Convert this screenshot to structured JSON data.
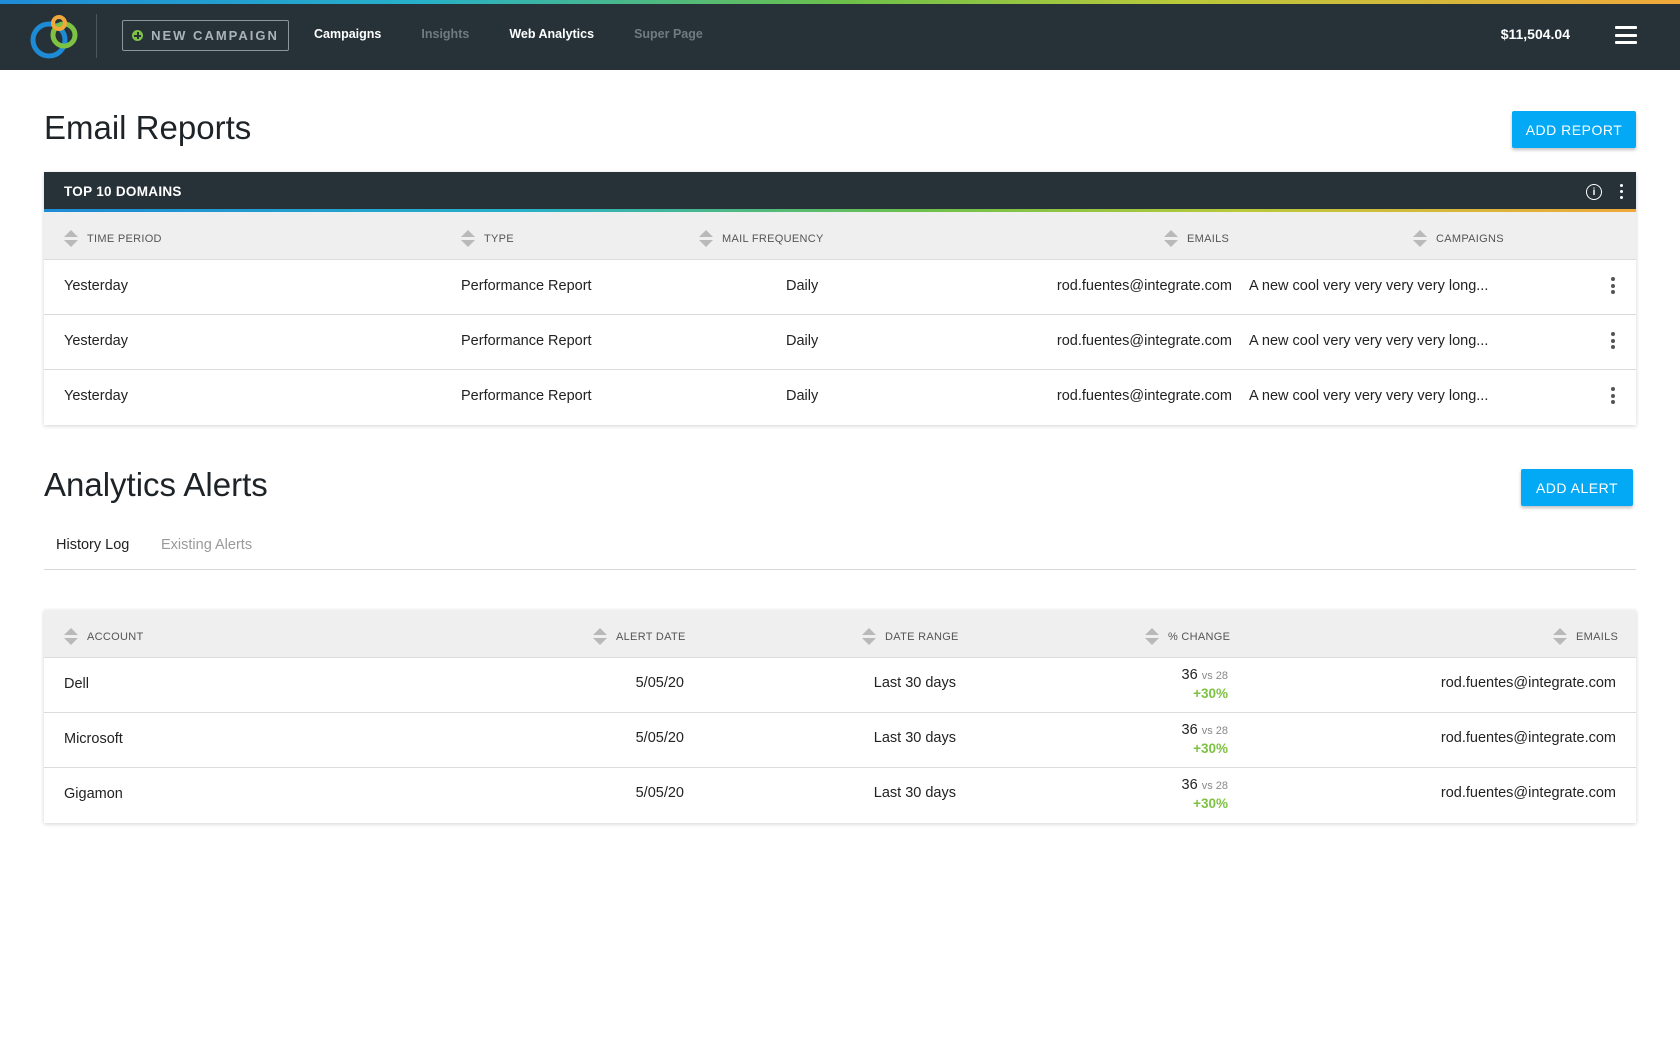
{
  "nav": {
    "new_campaign_label": "NEW CAMPAIGN",
    "links": [
      "Campaigns",
      "Insights",
      "Web Analytics",
      "Super Page"
    ],
    "balance": "$11,504.04"
  },
  "email_reports": {
    "title": "Email Reports",
    "add_button": "ADD REPORT",
    "card_title": "TOP 10 DOMAINS",
    "columns": [
      "TIME PERIOD",
      "TYPE",
      "MAIL FREQUENCY",
      "EMAILS",
      "CAMPAIGNS"
    ],
    "rows": [
      {
        "time_period": "Yesterday",
        "type": "Performance Report",
        "frequency": "Daily",
        "email": "rod.fuentes@integrate.com",
        "campaign": "A new cool very very very very long..."
      },
      {
        "time_period": "Yesterday",
        "type": "Performance Report",
        "frequency": "Daily",
        "email": "rod.fuentes@integrate.com",
        "campaign": "A new cool very very very very long..."
      },
      {
        "time_period": "Yesterday",
        "type": "Performance Report",
        "frequency": "Daily",
        "email": "rod.fuentes@integrate.com",
        "campaign": "A new cool very very very very long..."
      }
    ]
  },
  "analytics_alerts": {
    "title": "Analytics Alerts",
    "add_button": "ADD ALERT",
    "tabs": [
      "History Log",
      "Existing Alerts"
    ],
    "columns": [
      "ACCOUNT",
      "ALERT DATE",
      "DATE RANGE",
      "% CHANGE",
      "EMAILS"
    ],
    "rows": [
      {
        "account": "Dell",
        "alert_date": "5/05/20",
        "date_range": "Last 30 days",
        "value": "36",
        "vs": "vs 28",
        "change": "+30%",
        "email": "rod.fuentes@integrate.com"
      },
      {
        "account": "Microsoft",
        "alert_date": "5/05/20",
        "date_range": "Last 30 days",
        "value": "36",
        "vs": "vs 28",
        "change": "+30%",
        "email": "rod.fuentes@integrate.com"
      },
      {
        "account": "Gigamon",
        "alert_date": "5/05/20",
        "date_range": "Last 30 days",
        "value": "36",
        "vs": "vs 28",
        "change": "+30%",
        "email": "rod.fuentes@integrate.com"
      }
    ]
  },
  "colors": {
    "nav_bg": "#263238",
    "primary_button": "#03a9f4",
    "positive_change": "#7dc242"
  }
}
